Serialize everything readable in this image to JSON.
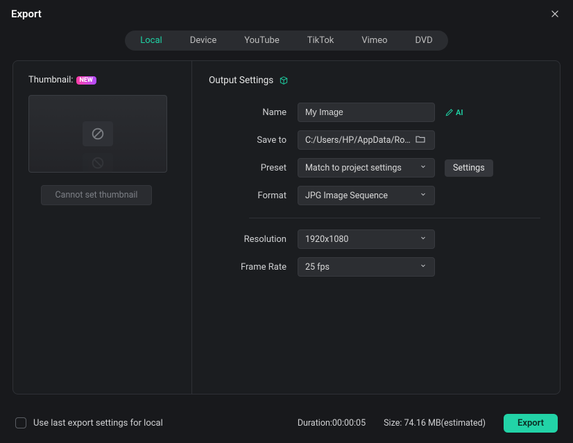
{
  "window": {
    "title": "Export"
  },
  "tabs": [
    {
      "label": "Local",
      "active": true
    },
    {
      "label": "Device",
      "active": false
    },
    {
      "label": "YouTube",
      "active": false
    },
    {
      "label": "TikTok",
      "active": false
    },
    {
      "label": "Vimeo",
      "active": false
    },
    {
      "label": "DVD",
      "active": false
    }
  ],
  "thumbnail": {
    "label": "Thumbnail:",
    "badge": "NEW",
    "set_button": "Cannot set thumbnail"
  },
  "output": {
    "section_title": "Output Settings",
    "labels": {
      "name": "Name",
      "save_to": "Save to",
      "preset": "Preset",
      "format": "Format",
      "resolution": "Resolution",
      "frame_rate": "Frame Rate"
    },
    "values": {
      "name": "My Image",
      "save_to": "C:/Users/HP/AppData/Roamin",
      "preset": "Match to project settings",
      "format": "JPG Image Sequence",
      "resolution": "1920x1080",
      "frame_rate": "25 fps"
    },
    "ai_label": "AI",
    "settings_button": "Settings"
  },
  "footer": {
    "checkbox_label": "Use last export settings for local",
    "duration_label": "Duration:",
    "duration_value": "00:00:05",
    "size_label": "Size:",
    "size_value": "74.16 MB(estimated)",
    "export_button": "Export"
  },
  "colors": {
    "accent": "#1ed2a4"
  }
}
